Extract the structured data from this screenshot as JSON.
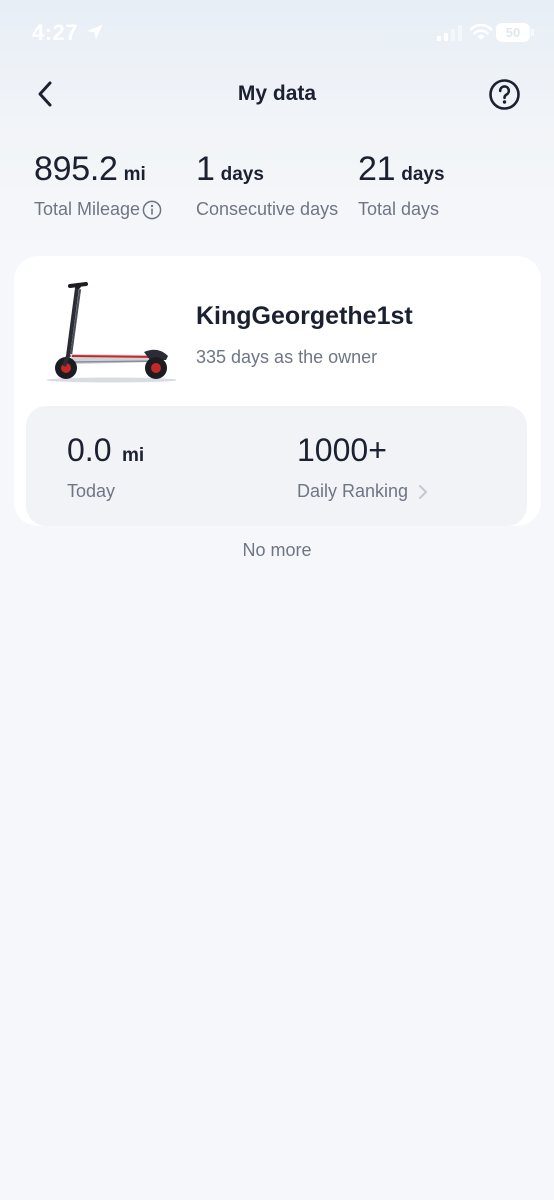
{
  "status_bar": {
    "time": "4:27",
    "battery": "50",
    "icons": [
      "location-arrow-icon",
      "cellular-signal-icon",
      "wifi-icon",
      "battery-icon"
    ]
  },
  "header": {
    "title": "My data",
    "back_icon": "chevron-left-icon",
    "help_icon": "question-circle-icon"
  },
  "stats": {
    "total_mileage": {
      "value": "895.2",
      "unit": "mi",
      "label": "Total Mileage",
      "icon": "info-icon"
    },
    "consecutive_days": {
      "value": "1",
      "unit": "days",
      "label": "Consecutive days"
    },
    "total_days": {
      "value": "21",
      "unit": "days",
      "label": "Total days"
    }
  },
  "vehicle_card": {
    "name": "KingGeorgethe1st",
    "owner_text": "335 days as the owner",
    "image": "electric-scooter",
    "today": {
      "value": "0.0",
      "unit": "mi",
      "label": "Today"
    },
    "ranking": {
      "value": "1000+",
      "label": "Daily Ranking",
      "icon": "chevron-right-icon"
    }
  },
  "footer": {
    "no_more": "No more"
  },
  "colors": {
    "primary_text": "#1b2130",
    "secondary_text": "#6e7685",
    "background": "#f6f7fa",
    "card": "#ffffff",
    "inner_panel": "#f2f3f7"
  }
}
